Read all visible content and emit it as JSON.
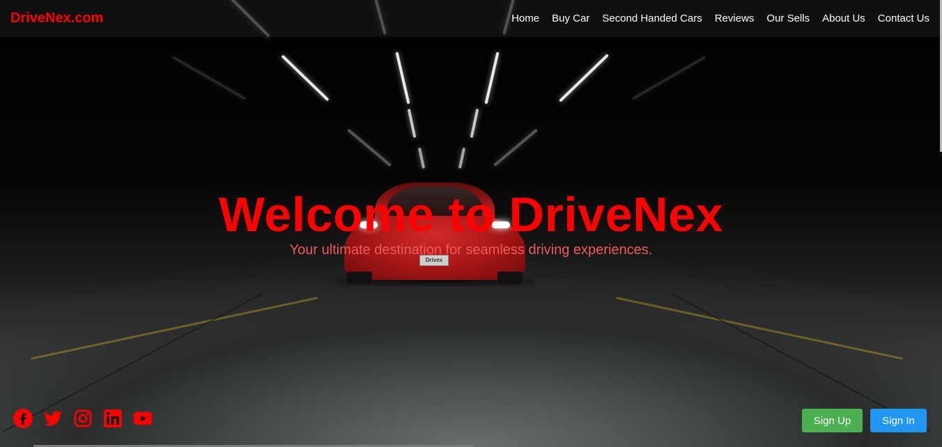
{
  "navbar": {
    "logo": "DriveNex.com",
    "links": [
      "Home",
      "Buy Car",
      "Second Handed Cars",
      "Reviews",
      "Our Sells",
      "About Us",
      "Contact Us"
    ]
  },
  "hero": {
    "title": "Welcome to DriveNex",
    "subtitle": "Your ultimate destination for seamless driving experiences."
  },
  "car": {
    "plate": "Drivex"
  },
  "socials": [
    {
      "icon": "facebook-icon"
    },
    {
      "icon": "twitter-icon"
    },
    {
      "icon": "instagram-icon"
    },
    {
      "icon": "linkedin-icon"
    },
    {
      "icon": "youtube-icon"
    }
  ],
  "auth": {
    "signup_label": "Sign Up",
    "signin_label": "Sign In"
  },
  "colors": {
    "brand": "#ff0000",
    "signup": "#4caf50",
    "signin": "#2196f3"
  }
}
